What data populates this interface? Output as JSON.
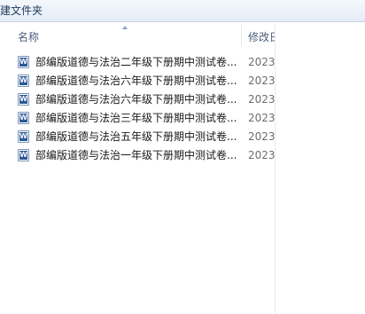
{
  "toolbar": {
    "new_folder_label": "建文件夹"
  },
  "columns": {
    "name_label": "名称",
    "date_label": "修改日"
  },
  "files": [
    {
      "name": "部编版道德与法治二年级下册期中测试卷...",
      "date": "2023,",
      "icon": "word-document-icon"
    },
    {
      "name": "部编版道德与法治六年级下册期中测试卷...",
      "date": "2023,",
      "icon": "word-document-icon"
    },
    {
      "name": "部编版道德与法治六年级下册期中测试卷...",
      "date": "2023,",
      "icon": "word-document-icon"
    },
    {
      "name": "部编版道德与法治三年级下册期中测试卷...",
      "date": "2023,",
      "icon": "word-document-icon"
    },
    {
      "name": "部编版道德与法治五年级下册期中测试卷...",
      "date": "2023,",
      "icon": "word-document-icon"
    },
    {
      "name": "部编版道德与法治一年级下册期中测试卷...",
      "date": "2023,",
      "icon": "word-document-icon"
    }
  ],
  "icon_glyph": "W"
}
